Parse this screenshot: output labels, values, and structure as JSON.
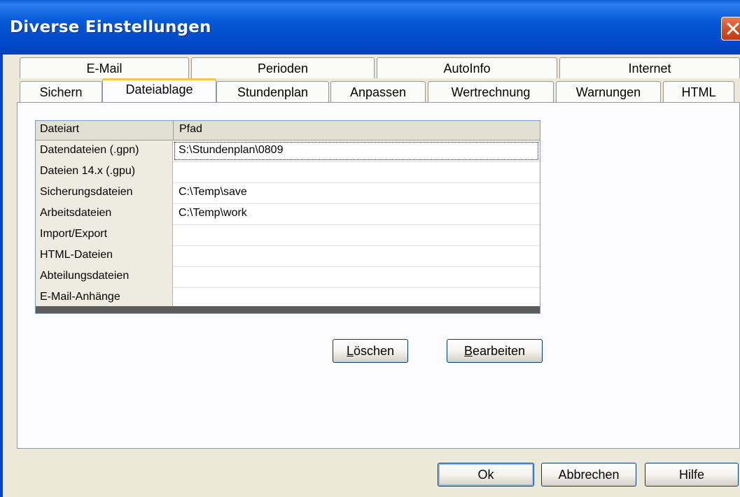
{
  "window": {
    "title": "Diverse Einstellungen"
  },
  "tabs_top": [
    {
      "label": "E-Mail"
    },
    {
      "label": "Perioden"
    },
    {
      "label": "AutoInfo"
    },
    {
      "label": "Internet"
    }
  ],
  "tabs_bottom": [
    {
      "label": "Sichern"
    },
    {
      "label": "Dateiablage",
      "active": true
    },
    {
      "label": "Stundenplan"
    },
    {
      "label": "Anpassen"
    },
    {
      "label": "Wertrechnung"
    },
    {
      "label": "Warnungen"
    },
    {
      "label": "HTML"
    }
  ],
  "grid": {
    "headers": [
      "Dateiart",
      "Pfad"
    ],
    "rows": [
      {
        "type": "Datendateien (.gpn)",
        "path": "S:\\Stundenplan\\0809"
      },
      {
        "type": "Dateien 14.x (.gpu)",
        "path": ""
      },
      {
        "type": "Sicherungsdateien",
        "path": "C:\\Temp\\save"
      },
      {
        "type": "Arbeitsdateien",
        "path": "C:\\Temp\\work"
      },
      {
        "type": "Import/Export",
        "path": ""
      },
      {
        "type": "HTML-Dateien",
        "path": ""
      },
      {
        "type": "Abteilungsdateien",
        "path": ""
      },
      {
        "type": "E-Mail-Anhänge",
        "path": ""
      }
    ]
  },
  "buttons": {
    "delete": {
      "mnemonic": "L",
      "rest": "öschen"
    },
    "edit": {
      "mnemonic": "B",
      "rest": "earbeiten"
    },
    "ok": "Ok",
    "cancel": "Abbrechen",
    "help": "Hilfe"
  },
  "colors": {
    "titlebar": "#0046C9",
    "dialog": "#ECE9D8",
    "active_tab_accent": "#FFC83C",
    "close_button": "#D24C23"
  },
  "icons": {
    "close": "close-icon"
  }
}
